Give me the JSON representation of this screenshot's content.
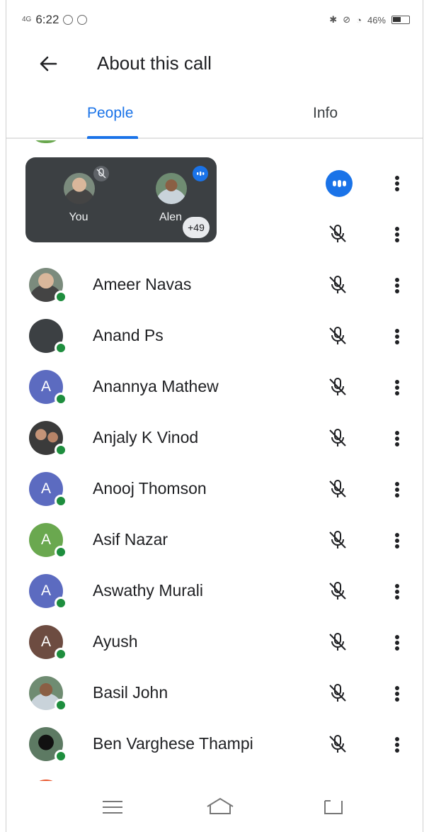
{
  "status_bar": {
    "network": "4G",
    "time": "6:22",
    "battery_percent": "46%",
    "right_icons": [
      "bluetooth-icon",
      "mute-icon",
      "volte-icon",
      "speed-icon",
      "wifi-icon"
    ]
  },
  "app_bar": {
    "back_icon": "arrow-left-icon",
    "title": "About this call"
  },
  "tabs": [
    {
      "label": "People",
      "selected": true
    },
    {
      "label": "Info",
      "selected": false
    }
  ],
  "tile": {
    "you_label": "You",
    "other_label": "Alen",
    "more_count": "+49"
  },
  "participants": [
    {
      "name": "",
      "avatar_type": "photo",
      "status": "speaking"
    },
    {
      "name": "",
      "avatar_type": "photo",
      "status": "muted"
    },
    {
      "name": "Ameer Navas",
      "avatar_type": "photo",
      "initial": "",
      "status": "muted"
    },
    {
      "name": "Anand Ps",
      "avatar_type": "solid",
      "initial": "",
      "color": "#3c4043",
      "status": "muted"
    },
    {
      "name": "Anannya Mathew",
      "avatar_type": "initial",
      "initial": "A",
      "color": "#5c6bc0",
      "status": "muted"
    },
    {
      "name": "Anjaly K Vinod",
      "avatar_type": "photo",
      "initial": "",
      "status": "muted"
    },
    {
      "name": "Anooj Thomson",
      "avatar_type": "initial",
      "initial": "A",
      "color": "#5c6bc0",
      "status": "muted"
    },
    {
      "name": "Asif Nazar",
      "avatar_type": "initial",
      "initial": "A",
      "color": "#6aa84f",
      "status": "muted"
    },
    {
      "name": "Aswathy Murali",
      "avatar_type": "initial",
      "initial": "A",
      "color": "#5c6bc0",
      "status": "muted"
    },
    {
      "name": "Ayush",
      "avatar_type": "initial",
      "initial": "A",
      "color": "#6d4c41",
      "status": "muted"
    },
    {
      "name": "Basil John",
      "avatar_type": "photo",
      "initial": "",
      "status": "muted"
    },
    {
      "name": "Ben Varghese Thampi",
      "avatar_type": "photo",
      "initial": "",
      "status": "muted"
    }
  ],
  "colors": {
    "accent": "#1a73e8",
    "online": "#1e8e3e",
    "tile_bg": "#3c4043"
  },
  "nav_bar": [
    "menu-icon",
    "home-icon",
    "back-nav-icon"
  ]
}
